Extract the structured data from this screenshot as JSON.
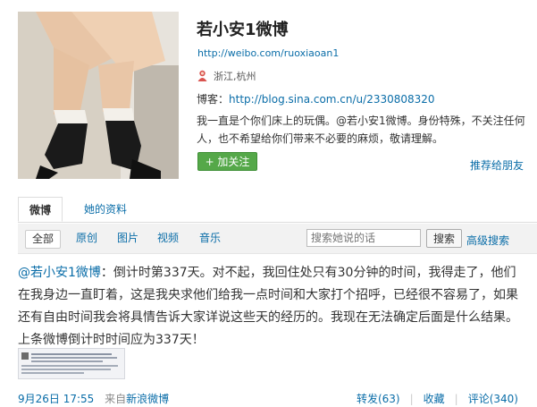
{
  "profile": {
    "name": "若小安1微博",
    "url": "http://weibo.com/ruoxiaoan1",
    "location": "浙江,杭州",
    "blog_label": "博客：",
    "blog_url": "http://blog.sina.com.cn/u/2330808320",
    "bio": "我一直是个你们床上的玩偶。@若小安1微博。身份特殊，不关注任何人，也不希望给你们带来不必要的麻烦，敬请理解。",
    "follow_label": "+ 加关注",
    "recommend_label": "推荐给朋友"
  },
  "tabs": [
    {
      "label": "微博"
    },
    {
      "label": "她的资料"
    }
  ],
  "filters": [
    {
      "label": "全部"
    },
    {
      "label": "原创"
    },
    {
      "label": "图片"
    },
    {
      "label": "视频"
    },
    {
      "label": "音乐"
    }
  ],
  "search": {
    "placeholder": "搜索她说的话",
    "button_label": "搜索",
    "advanced_label": "高级搜索"
  },
  "post": {
    "author": "@若小安1微博",
    "text": "：倒计时第337天。对不起，我回住处只有30分钟的时间，我得走了，他们在我身边一直盯着，这是我央求他们给我一点时间和大家打个招呼，已经很不容易了，如果还有自由时间我会将具情告诉大家详说这些天的经历的。我现在无法确定后面是什么结果。上条微博倒计时时间应为337天！",
    "time": "9月26日 17:55",
    "source_prefix": "来自",
    "source": "新浪微博",
    "repost_label": "转发(63)",
    "fav_label": "收藏",
    "comment_label": "评论(340)"
  },
  "colors": {
    "link": "#0a6da8",
    "follow_button": "#55a849"
  }
}
